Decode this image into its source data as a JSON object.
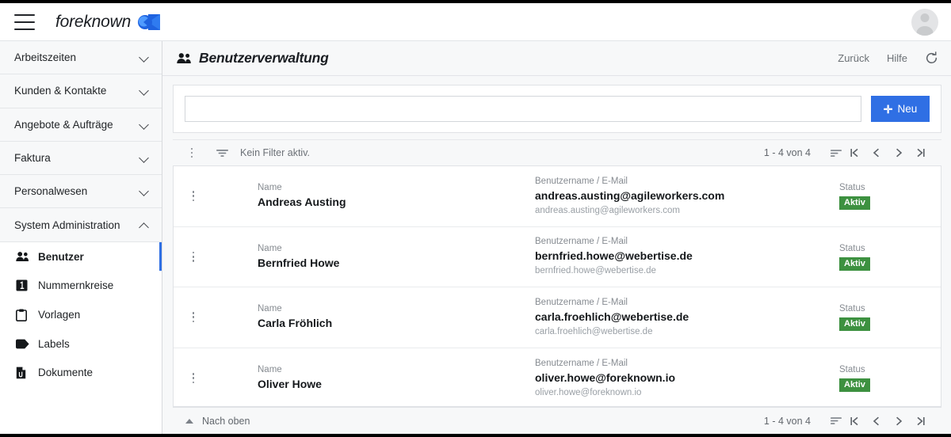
{
  "topbar": {
    "menu_icon": "hamburger-icon",
    "brand_name": "foreknown",
    "avatar_icon": "user-avatar-icon"
  },
  "sidebar": {
    "groups": [
      {
        "label": "Arbeitszeiten",
        "expanded": false
      },
      {
        "label": "Kunden & Kontakte",
        "expanded": false
      },
      {
        "label": "Angebote & Aufträge",
        "expanded": false
      },
      {
        "label": "Faktura",
        "expanded": false
      },
      {
        "label": "Personalwesen",
        "expanded": false
      },
      {
        "label": "System Administration",
        "expanded": true
      }
    ],
    "items": [
      {
        "label": "Benutzer",
        "icon": "people-icon",
        "active": true
      },
      {
        "label": "Nummernkreise",
        "icon": "number-box-icon",
        "active": false
      },
      {
        "label": "Vorlagen",
        "icon": "clipboard-icon",
        "active": false
      },
      {
        "label": "Labels",
        "icon": "tag-icon",
        "active": false
      },
      {
        "label": "Dokumente",
        "icon": "document-icon",
        "active": false
      }
    ]
  },
  "page": {
    "title": "Benutzerverwaltung",
    "title_icon": "people-icon",
    "back_label": "Zurück",
    "help_label": "Hilfe",
    "refresh_icon": "refresh-icon"
  },
  "search": {
    "value": "",
    "placeholder": "",
    "new_button_label": "Neu",
    "new_button_icon": "plus-icon",
    "accent_color": "#2f6fe4"
  },
  "toolbar": {
    "kebab_icon": "more-vertical-icon",
    "filter_icon": "filter-icon",
    "filter_text": "Kein Filter aktiv.",
    "pagination_count": "1 - 4 von 4",
    "sort_icon": "sort-icon",
    "first_icon": "first-page-icon",
    "prev_icon": "previous-page-icon",
    "next_icon": "next-page-icon",
    "last_icon": "last-page-icon"
  },
  "list": {
    "labels": {
      "name": "Name",
      "username_email": "Benutzername / E-Mail",
      "status": "Status"
    },
    "rows": [
      {
        "name": "Andreas Austing",
        "email": "andreas.austing@agileworkers.com",
        "username": "andreas.austing@agileworkers.com",
        "status": "Aktiv"
      },
      {
        "name": "Bernfried Howe",
        "email": "bernfried.howe@webertise.de",
        "username": "bernfried.howe@webertise.de",
        "status": "Aktiv"
      },
      {
        "name": "Carla Fröhlich",
        "email": "carla.froehlich@webertise.de",
        "username": "carla.froehlich@webertise.de",
        "status": "Aktiv"
      },
      {
        "name": "Oliver Howe",
        "email": "oliver.howe@foreknown.io",
        "username": "oliver.howe@foreknown.io",
        "status": "Aktiv"
      }
    ],
    "status_color": "#3d9140"
  },
  "footer": {
    "top_label": "Nach oben",
    "top_icon": "arrow-up-icon",
    "pagination_count": "1 - 4 von 4",
    "sort_icon": "sort-icon",
    "first_icon": "first-page-icon",
    "prev_icon": "previous-page-icon",
    "next_icon": "next-page-icon",
    "last_icon": "last-page-icon"
  }
}
